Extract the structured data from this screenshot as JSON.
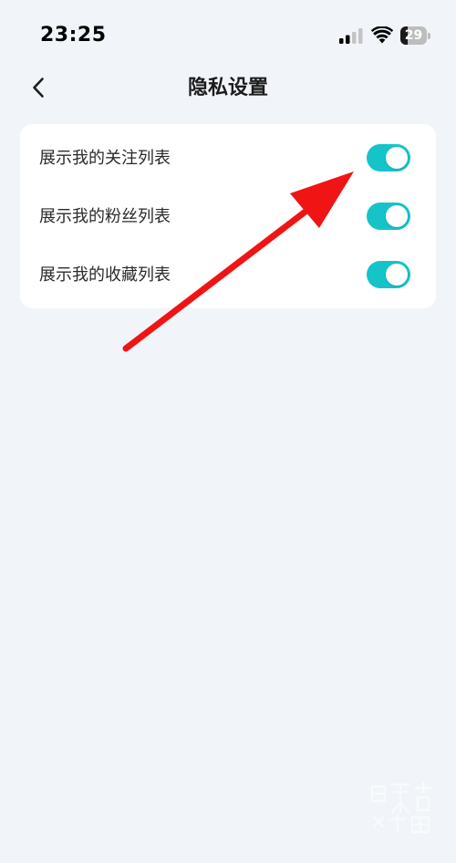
{
  "status_bar": {
    "time": "23:25",
    "battery_level": "29",
    "battery_fraction": 0.29
  },
  "nav": {
    "title": "隐私设置",
    "back_icon": "chevron-left-icon"
  },
  "settings": {
    "items": [
      {
        "label": "展示我的关注列表",
        "enabled": true
      },
      {
        "label": "展示我的粉丝列表",
        "enabled": true
      },
      {
        "label": "展示我的收藏列表",
        "enabled": true
      }
    ]
  },
  "colors": {
    "background": "#f1f5f9",
    "card": "#ffffff",
    "toggle_on": "#14c4c9",
    "annotation_arrow": "#f01414"
  }
}
